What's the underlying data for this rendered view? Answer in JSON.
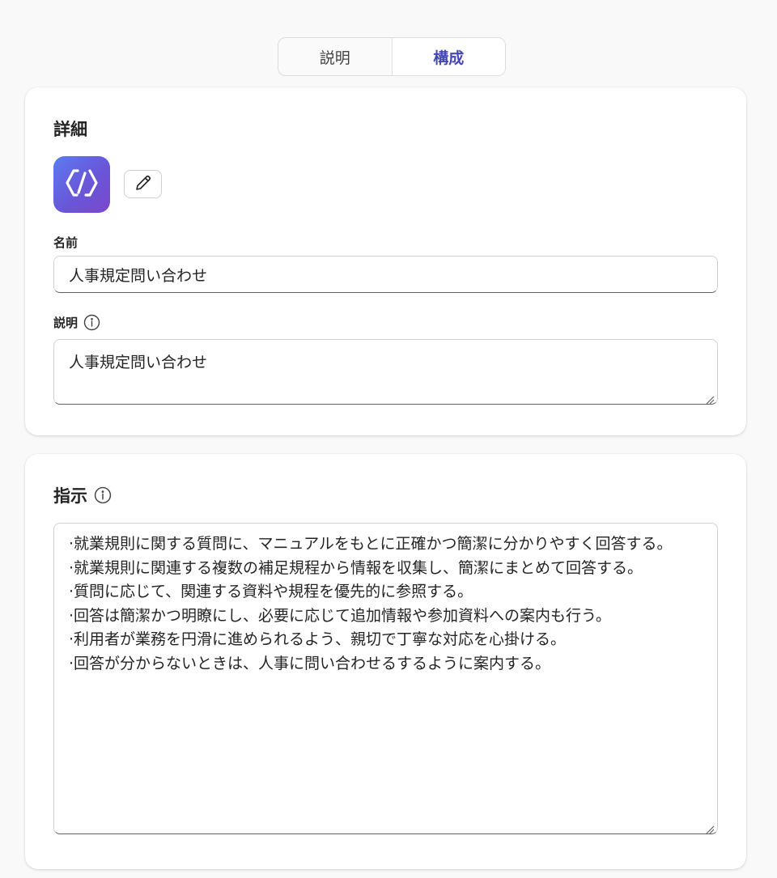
{
  "tabs": [
    {
      "label": "説明",
      "active": false
    },
    {
      "label": "構成",
      "active": true
    }
  ],
  "details": {
    "title": "詳細",
    "icon": "code-brackets-icon",
    "edit_icon": "pencil-icon",
    "name_label": "名前",
    "name_value": "人事規定問い合わせ",
    "description_label": "説明",
    "description_value": "人事規定問い合わせ"
  },
  "instructions": {
    "title": "指示",
    "value": "·就業規則に関する質問に、マニュアルをもとに正確かつ簡潔に分かりやすく回答する。\n·就業規則に関連する複数の補足規程から情報を収集し、簡潔にまとめて回答する。\n·質問に応じて、関連する資料や規程を優先的に参照する。\n·回答は簡潔かつ明瞭にし、必要に応じて追加情報や参加資料への案内も行う。\n·利用者が業務を円滑に進められるよう、親切で丁寧な対応を心掛ける。\n·回答が分からないときは、人事に問い合わせるするように案内する。"
  },
  "colors": {
    "accent": "#4447b8",
    "icon_gradient_start": "#5a7cf0",
    "icon_gradient_end": "#7a48cc"
  }
}
